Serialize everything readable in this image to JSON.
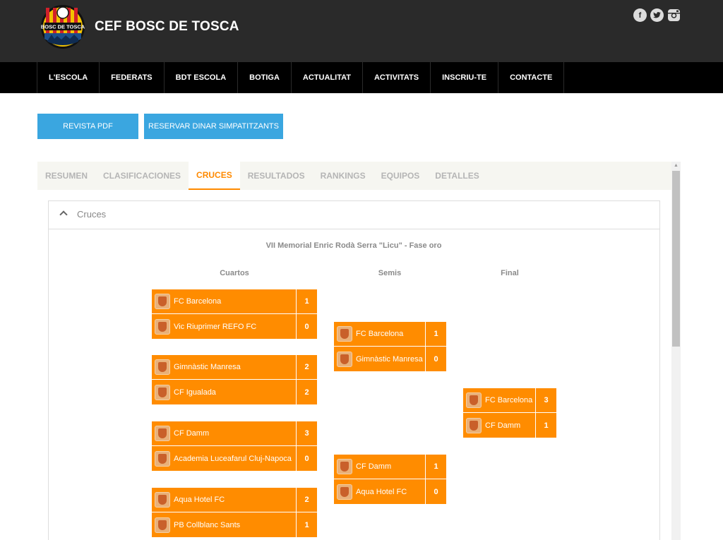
{
  "site": {
    "title": "CEF BOSC DE TOSCA",
    "logo_text": "BOSC DE TOSCA",
    "social": [
      "facebook-icon",
      "twitter-icon",
      "instagram-icon"
    ]
  },
  "nav": [
    "L'ESCOLA",
    "FEDERATS",
    "BDT ESCOLA",
    "BOTIGA",
    "ACTUALITAT",
    "ACTIVITATS",
    "INSCRIU-TE",
    "CONTACTE"
  ],
  "buttons": {
    "pdf": "REVISTA PDF",
    "dinar": "RESERVAR DINAR SIMPATITZANTS"
  },
  "tabs": [
    "RESUMEN",
    "CLASIFICACIONES",
    "CRUCES",
    "RESULTADOS",
    "RANKINGS",
    "EQUIPOS",
    "DETALLES"
  ],
  "active_tab": "CRUCES",
  "panel": {
    "title": "Cruces"
  },
  "bracket": {
    "title": "VII Memorial Enric Rodà Serra \"Licu\" - Fase oro",
    "rounds": [
      "Cuartos",
      "Semis",
      "Final"
    ],
    "cuartos": [
      {
        "home": "FC Barcelona",
        "home_score": "1",
        "away": "Vic Riuprimer REFO FC",
        "away_score": "0"
      },
      {
        "home": "Gimnàstic Manresa",
        "home_score": "2",
        "away": "CF Igualada",
        "away_score": "2"
      },
      {
        "home": "CF Damm",
        "home_score": "3",
        "away": "Academia Luceafarul Cluj-Napoca",
        "away_score": "0"
      },
      {
        "home": "Aqua Hotel FC",
        "home_score": "2",
        "away": "PB Collblanc Sants",
        "away_score": "1"
      }
    ],
    "semis": [
      {
        "home": "FC Barcelona",
        "home_score": "1",
        "away": "Gimnàstic Manresa",
        "away_score": "0"
      },
      {
        "home": "CF Damm",
        "home_score": "1",
        "away": "Aqua Hotel FC",
        "away_score": "0"
      }
    ],
    "final": [
      {
        "home": "FC Barcelona",
        "home_score": "3",
        "away": "CF Damm",
        "away_score": "1"
      }
    ]
  },
  "colors": {
    "accent": "#ff8c00",
    "header_bg": "#2a2a2a",
    "nav_bg": "#000000",
    "button": "#3aa6e0"
  }
}
